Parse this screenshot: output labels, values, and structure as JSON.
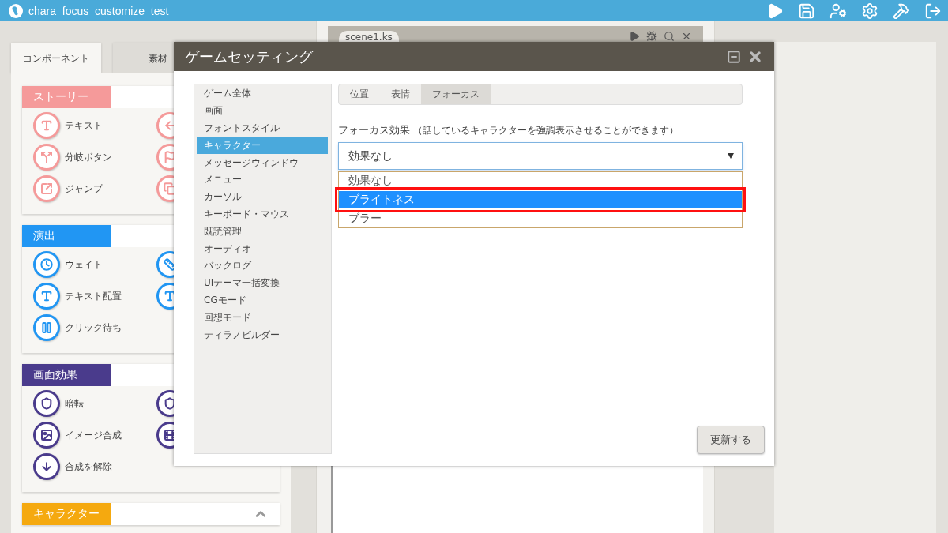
{
  "app_bar": {
    "title": "chara_focus_customize_test"
  },
  "left_panel": {
    "tabs": [
      {
        "label": "コンポーネント",
        "selected": true
      },
      {
        "label": "素材",
        "selected": false
      }
    ],
    "sections": [
      {
        "title": "ストーリー",
        "color": "#f59a9a",
        "items": [
          {
            "kind": "labeled",
            "label": "テキスト"
          },
          {
            "kind": "covered"
          },
          {
            "kind": "labeled",
            "label": "分岐ボタン"
          },
          {
            "kind": "covered"
          },
          {
            "kind": "labeled",
            "label": "ジャンプ"
          },
          {
            "kind": "covered"
          }
        ]
      },
      {
        "title": "演出",
        "color": "#2196f3",
        "items": [
          {
            "kind": "labeled",
            "label": "ウェイト"
          },
          {
            "kind": "covered"
          },
          {
            "kind": "labeled",
            "label": "テキスト配置"
          },
          {
            "kind": "covered"
          },
          {
            "kind": "labeled",
            "label": "クリック待ち"
          }
        ]
      },
      {
        "title": "画面効果",
        "color": "#4a3b8c",
        "items": [
          {
            "kind": "labeled",
            "label": "暗転"
          },
          {
            "kind": "covered"
          },
          {
            "kind": "labeled",
            "label": "イメージ合成"
          },
          {
            "kind": "covered"
          },
          {
            "kind": "labeled",
            "label": "合成を解除"
          }
        ]
      },
      {
        "title": "キャラクター",
        "color": "#f5a90f"
      }
    ]
  },
  "editor": {
    "tab": "scene1.ks"
  },
  "dialog": {
    "title": "ゲームセッティング",
    "menu": [
      {
        "label": "ゲーム全体",
        "selected": false
      },
      {
        "label": "画面",
        "selected": false
      },
      {
        "label": "フォントスタイル",
        "selected": false
      },
      {
        "label": "キャラクター",
        "selected": true
      },
      {
        "label": "メッセージウィンドウ",
        "selected": false
      },
      {
        "label": "メニュー",
        "selected": false
      },
      {
        "label": "カーソル",
        "selected": false
      },
      {
        "label": "キーボード・マウス",
        "selected": false
      },
      {
        "label": "既読管理",
        "selected": false
      },
      {
        "label": "オーディオ",
        "selected": false
      },
      {
        "label": "バックログ",
        "selected": false
      },
      {
        "label": "UIテーマ一括変換",
        "selected": false
      },
      {
        "label": "CGモード",
        "selected": false
      },
      {
        "label": "回想モード",
        "selected": false
      },
      {
        "label": "ティラノビルダー",
        "selected": false
      }
    ],
    "tabs": [
      {
        "label": "位置",
        "selected": false
      },
      {
        "label": "表情",
        "selected": false
      },
      {
        "label": "フォーカス",
        "selected": true
      }
    ],
    "field": {
      "label": "フォーカス効果",
      "hint": "（話しているキャラクターを強調表示させることができます）",
      "value": "効果なし",
      "expanded": true,
      "options": [
        {
          "label": "効果なし",
          "highlighted": false,
          "outlined": false
        },
        {
          "label": "ブライトネス",
          "highlighted": true,
          "outlined": true
        },
        {
          "label": "ブラー",
          "highlighted": false,
          "outlined": false
        }
      ]
    },
    "button": "更新する"
  }
}
